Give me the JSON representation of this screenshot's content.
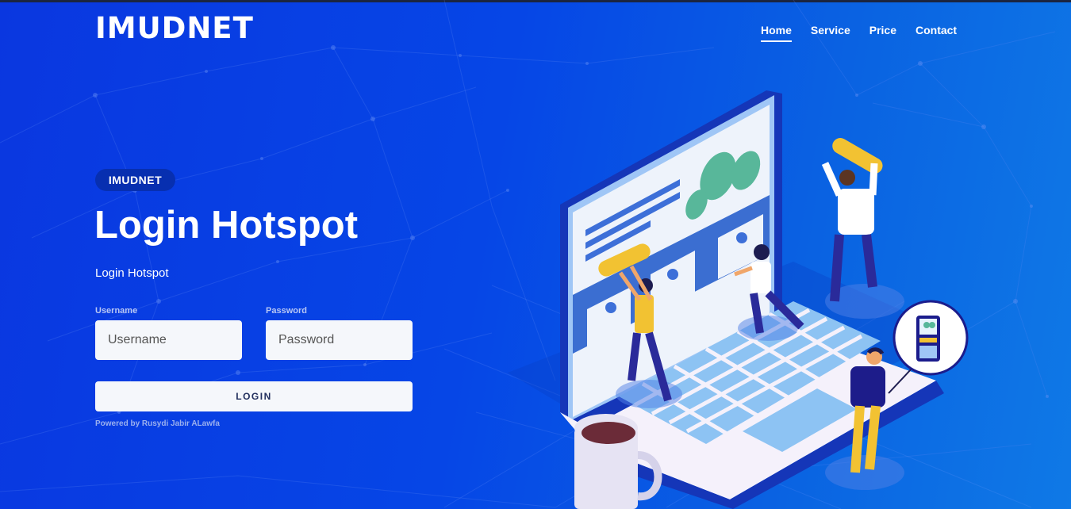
{
  "header": {
    "brand": "IMUDNET",
    "nav": [
      "Home",
      "Service",
      "Price",
      "Contact"
    ]
  },
  "hero": {
    "badge": "IMUDNET",
    "title": "Login Hotspot",
    "subtitle": "Login Hotspot"
  },
  "form": {
    "username_label": "Username",
    "username_placeholder": "Username",
    "password_label": "Password",
    "password_placeholder": "Password",
    "login_label": "LOGIN"
  },
  "footer": {
    "powered": "Powered by Rusydi Jabir ALawfa"
  },
  "colors": {
    "background_start": "#0a37e0",
    "background_end": "#0f79e6",
    "badge": "#072fb0",
    "field": "#f5f7fb",
    "accent_yellow": "#f2c232"
  },
  "illustration": {
    "icon": "laptop-team-illustration"
  }
}
